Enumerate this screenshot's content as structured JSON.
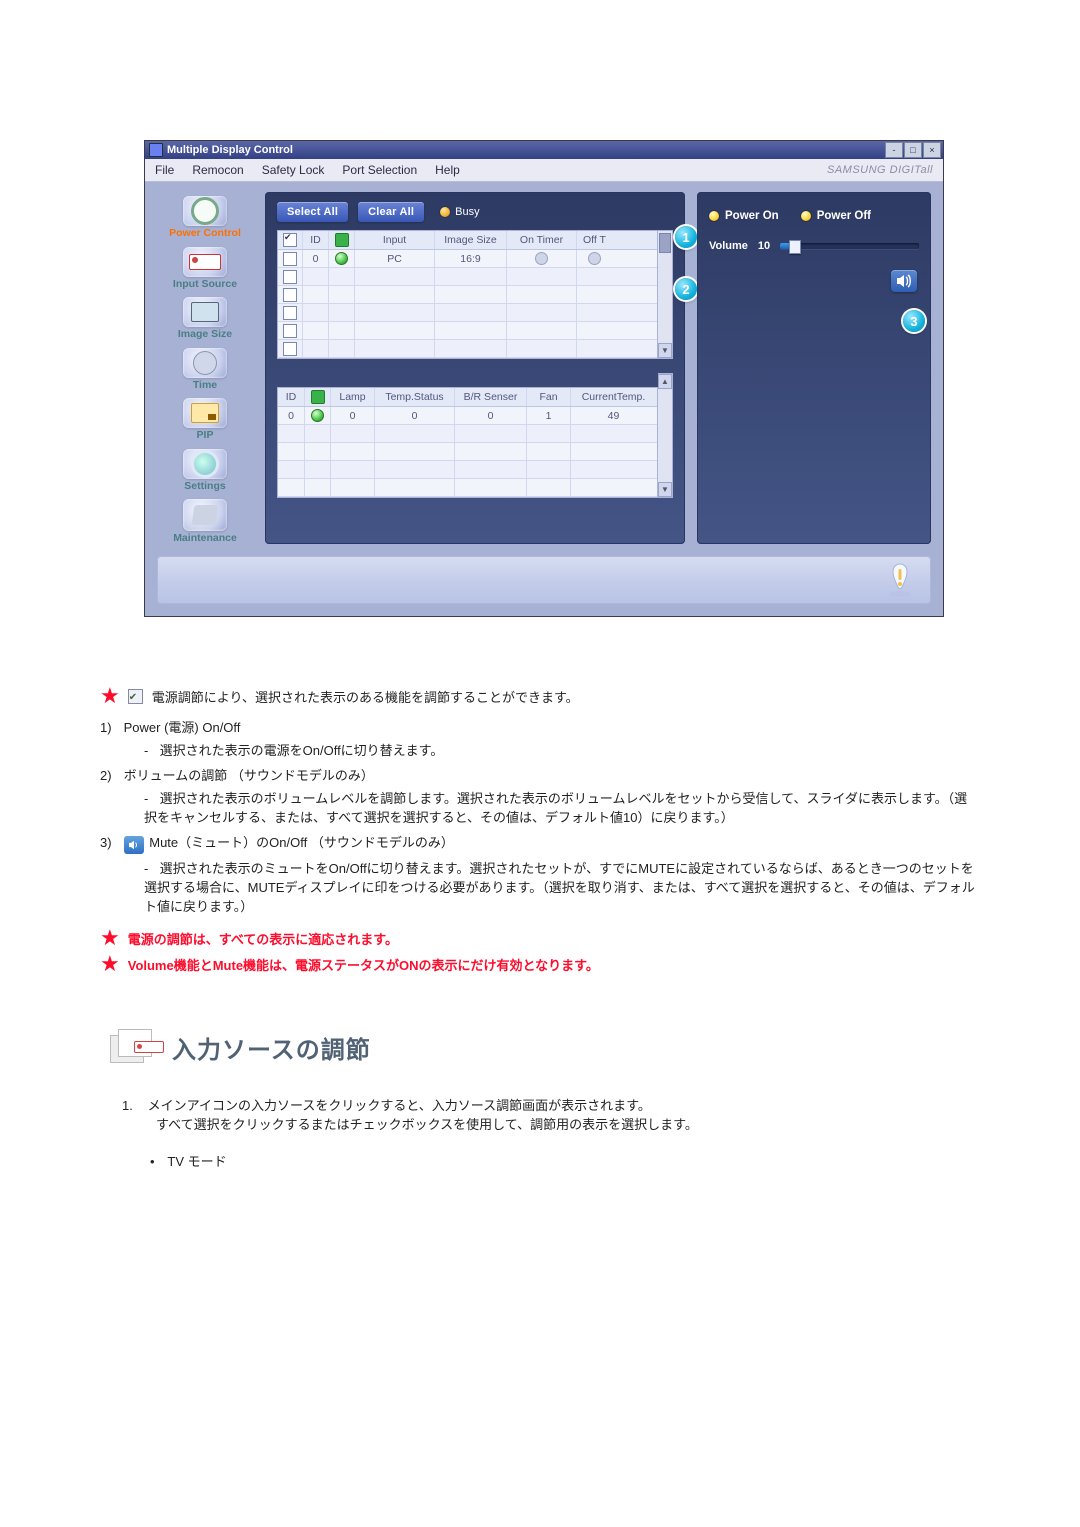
{
  "app": {
    "title": "Multiple Display Control",
    "brand": "SAMSUNG DIGITall",
    "window_controls": {
      "min": "-",
      "max": "□",
      "close": "×"
    },
    "menu": [
      "File",
      "Remocon",
      "Safety Lock",
      "Port Selection",
      "Help"
    ],
    "toolbar": {
      "select_all": "Select All",
      "clear_all": "Clear All",
      "busy": "Busy"
    },
    "sidebar": [
      {
        "label": "Power Control",
        "glyph": "power",
        "state": "active"
      },
      {
        "label": "Input Source",
        "glyph": "input-src",
        "state": "dim"
      },
      {
        "label": "Image Size",
        "glyph": "image-size",
        "state": "dim"
      },
      {
        "label": "Time",
        "glyph": "time",
        "state": "dim"
      },
      {
        "label": "PIP",
        "glyph": "pip",
        "state": "dim"
      },
      {
        "label": "Settings",
        "glyph": "settings",
        "state": "dim"
      },
      {
        "label": "Maintenance",
        "glyph": "maint",
        "state": "dim"
      }
    ],
    "grid1": {
      "headers": [
        "",
        "ID",
        "",
        "Input",
        "Image Size",
        "On Timer",
        "Off T"
      ],
      "rows": [
        {
          "checked": false,
          "id": "0",
          "status": "on",
          "input": "PC",
          "image_size": "16:9",
          "on_timer_dot": true,
          "off_t_dot": true
        }
      ],
      "empty_rows": 5
    },
    "grid2": {
      "headers": [
        "ID",
        "",
        "Lamp",
        "Temp.Status",
        "B/R Senser",
        "Fan",
        "CurrentTemp."
      ],
      "rows": [
        {
          "id": "0",
          "status": "on",
          "lamp": "0",
          "temp_status": "0",
          "br_senser": "0",
          "fan": "1",
          "current_temp": "49"
        }
      ],
      "empty_rows": 4
    },
    "right": {
      "power_on": "Power On",
      "power_off": "Power Off",
      "volume_label": "Volume",
      "volume_value": "10",
      "volume_percent": 10
    },
    "callouts": {
      "c1": "1",
      "c2": "2",
      "c3": "3"
    }
  },
  "doc": {
    "star1": "電源調節により、選択された表示のある機能を調節することができます。",
    "item1_num": "1)",
    "item1_title": "Power (電源) On/Off",
    "item1_sub": "選択された表示の電源をOn/Offに切り替えます。",
    "item2_num": "2)",
    "item2_title": "ボリュームの調節 （サウンドモデルのみ）",
    "item2_sub": "選択された表示のボリュームレベルを調節します。選択された表示のボリュームレベルをセットから受信して、スライダに表示します。（選択をキャンセルする、または、すべて選択を選択すると、その値は、デフォルト値10）に戻ります。）",
    "item3_num": "3)",
    "item3_title": "Mute（ミュート）のOn/Off （サウンドモデルのみ）",
    "item3_sub": "選択された表示のミュートをOn/Offに切り替えます。選択されたセットが、すでにMUTEに設定されているならば、あるとき一つのセットを選択する場合に、MUTEディスプレイに印をつける必要があります。（選択を取り消す、または、すべて選択を選択すると、その値は、デフォルト値に戻ります。）",
    "note1": "電源の調節は、すべての表示に適応されます。",
    "note2": "Volume機能とMute機能は、電源ステータスがONの表示にだけ有効となります。",
    "section_title": "入力ソースの調節",
    "ord1_num": "1.",
    "ord1_a": "メインアイコンの入力ソースをクリックすると、入力ソース調節画面が表示されます。",
    "ord1_b": "すべて選択をクリックするまたはチェックボックスを使用して、調節用の表示を選択します。",
    "bullet1": "TV モード"
  }
}
